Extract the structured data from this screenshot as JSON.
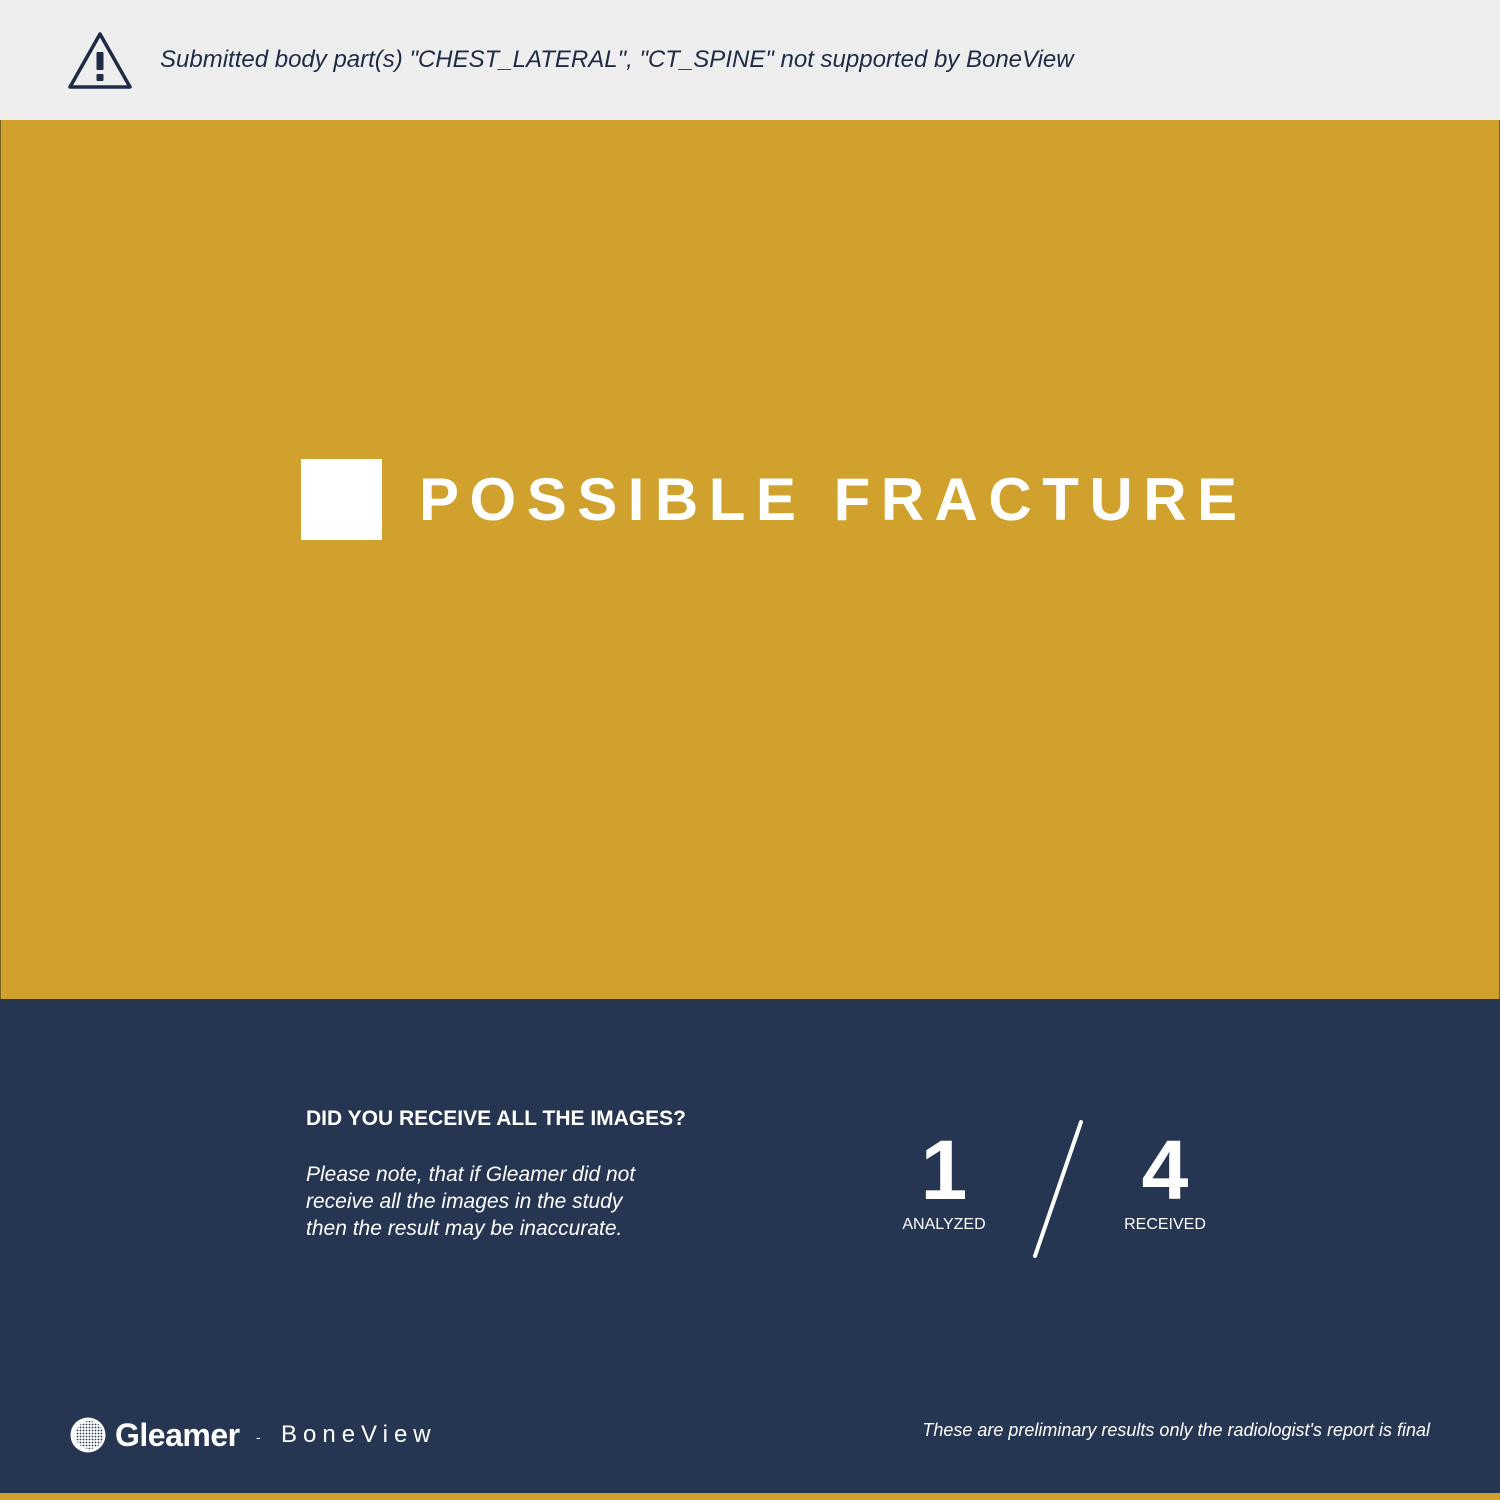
{
  "banner": {
    "icon": "warning-triangle-icon",
    "message": "Submitted body part(s) \"CHEST_LATERAL\", \"CT_SPINE\" not supported by BoneView"
  },
  "status": {
    "label": "POSSIBLE FRACTURE",
    "color": "#d1a12d",
    "marker_icon": "square-marker-icon"
  },
  "images": {
    "question": "DID YOU RECEIVE ALL THE IMAGES?",
    "note_lines": [
      "Please note, that if Gleamer did not",
      "receive all the images in the study",
      "then the result may be inaccurate."
    ],
    "analyzed": {
      "value": "1",
      "label": "ANALYZED"
    },
    "received": {
      "value": "4",
      "label": "RECEIVED"
    }
  },
  "footer": {
    "brand": "Gleamer",
    "separator": "-",
    "product": "BoneView",
    "disclaimer": "These are preliminary results only the radiologist's report is final"
  },
  "colors": {
    "banner_bg": "#eeeeee",
    "accent": "#d1a12d",
    "navy": "#253552",
    "text_dark": "#1f2a44"
  }
}
